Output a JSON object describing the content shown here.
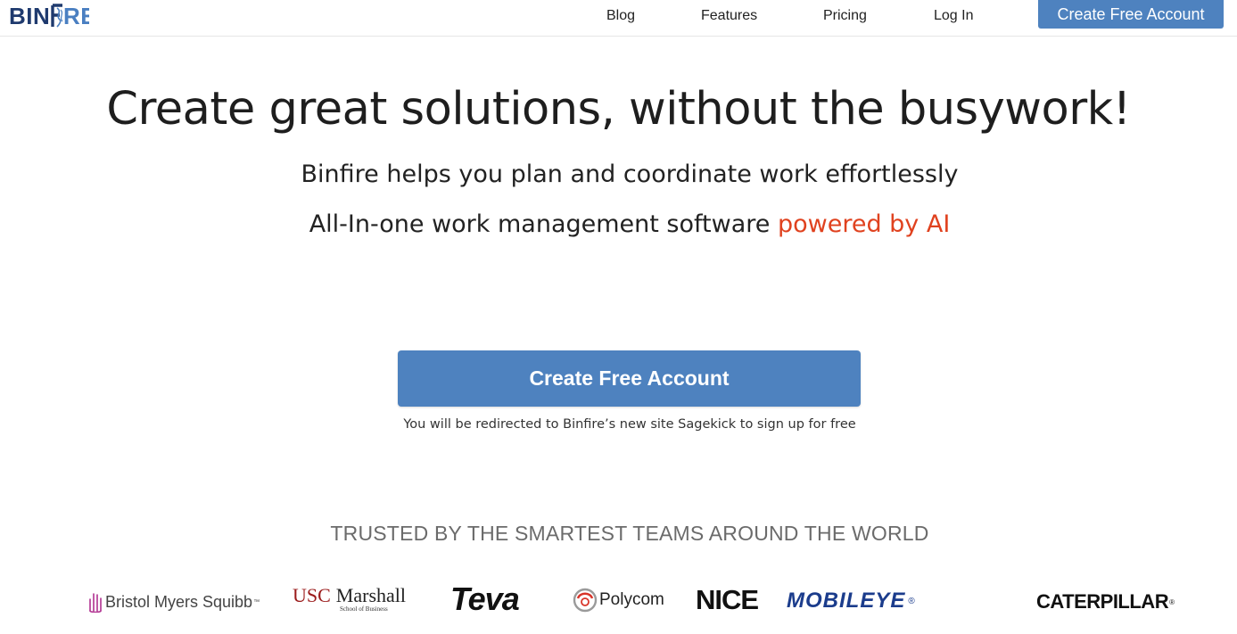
{
  "header": {
    "logo_text": "BINFIRE",
    "nav": {
      "blog": "Blog",
      "features": "Features",
      "pricing": "Pricing",
      "login": "Log In"
    },
    "cta_label": "Create Free Account"
  },
  "hero": {
    "title": "Create great solutions, without the busywork!",
    "subtitle_1": "Binfire helps you plan and coordinate work effortlessly",
    "subtitle_2_prefix": "All-In-one work management software ",
    "subtitle_2_highlight": "powered by AI",
    "cta_label": "Create Free Account",
    "redirect_note": "You will be redirected to Binfire’s new site Sagekick to sign up for free"
  },
  "trusted": {
    "heading": "TRUSTED BY THE SMARTEST TEAMS AROUND THE WORLD",
    "logos": {
      "bms": "Bristol Myers Squibb",
      "bms_tm": "™",
      "usc": "USC",
      "marshall": "Marshall",
      "marshall_school": "School of Business",
      "teva": "Teva",
      "polycom": "Polycom",
      "nice": "NICE",
      "mobileye": "MOBILEYE",
      "mobileye_reg": "®",
      "caterpillar": "CATERPILLAR",
      "caterpillar_reg": "®"
    }
  },
  "colors": {
    "primary_button": "#4e82bf",
    "logo_dark": "#1f3a6e",
    "logo_light": "#4a7fc1",
    "ai_highlight": "#e0421f",
    "trusted_text": "#6b6b6b"
  }
}
